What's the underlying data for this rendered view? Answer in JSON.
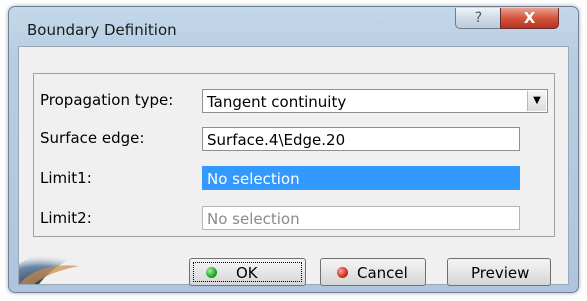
{
  "window": {
    "title": "Boundary Definition",
    "help_glyph": "?",
    "close_glyph": "X"
  },
  "form": {
    "propagation_label": "Propagation type:",
    "propagation_value": "Tangent continuity",
    "surface_edge_label": "Surface edge:",
    "surface_edge_value": "Surface.4\\Edge.20",
    "limit1_label": "Limit1:",
    "limit1_value": "No selection",
    "limit2_label": "Limit2:",
    "limit2_value": "No selection"
  },
  "buttons": {
    "ok_label": "OK",
    "cancel_label": "Cancel",
    "preview_label": "Preview"
  },
  "colors": {
    "ok_dot": "#1fa51f",
    "cancel_dot": "#d42a1a",
    "selection": "#3399ff"
  }
}
